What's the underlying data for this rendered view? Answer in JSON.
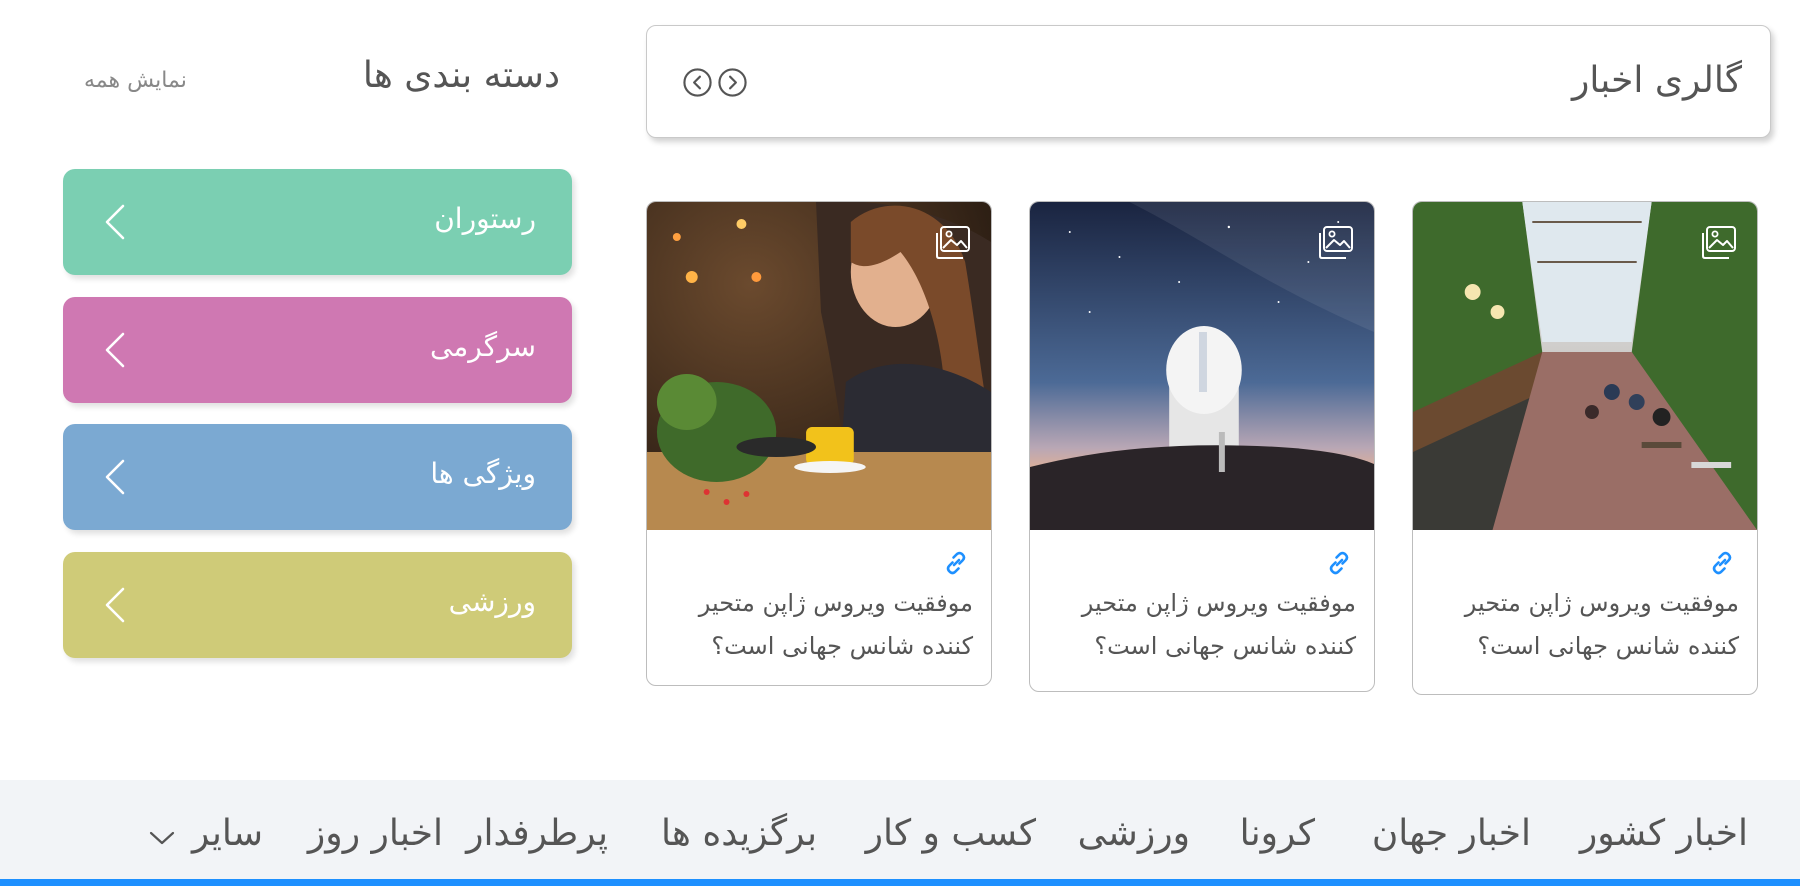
{
  "gallery": {
    "title": "گالری اخبار",
    "prev_icon": "chevron-left-circle-icon",
    "next_icon": "chevron-right-circle-icon"
  },
  "categories": {
    "title": "دسته بندی ها",
    "show_all": "نمایش همه",
    "items": [
      {
        "label": "رستوران",
        "color": "#7bcfb2",
        "icon": "chevron-left-icon"
      },
      {
        "label": "سرگرمی",
        "color": "#cf78b2",
        "icon": "chevron-left-icon"
      },
      {
        "label": "ویژگی ها",
        "color": "#7ba9d2",
        "icon": "chevron-left-icon"
      },
      {
        "label": "ورزشی",
        "color": "#cfcb78",
        "icon": "chevron-left-icon"
      }
    ]
  },
  "cards": [
    {
      "headline": "موفقیت ویروس ژاپن متحیر کننده شانس جهانی است؟",
      "image": "woman eating at restaurant table",
      "icons": [
        "gallery-icon",
        "link-icon"
      ]
    },
    {
      "headline": "موفقیت ویروس ژاپن متحیر کننده شانس جهانی است؟",
      "image": "observatory under starry sky",
      "icons": [
        "gallery-icon",
        "link-icon"
      ]
    },
    {
      "headline": "موفقیت ویروس ژاپن متحیر کننده شانس جهانی است؟",
      "image": "indoor market street with cafe seating",
      "icons": [
        "gallery-icon",
        "link-icon"
      ]
    }
  ],
  "nav": {
    "items": [
      "اخبار کشور",
      "اخبار جهان",
      "کرونا",
      "ورزشی",
      "کسب و کار",
      "برگزیده ها",
      "پرطرفدار",
      "اخبار روز"
    ],
    "more_label": "سایر",
    "more_icon": "chevron-down-icon",
    "accent": "#1e90ff",
    "background": "#f2f4f7"
  }
}
